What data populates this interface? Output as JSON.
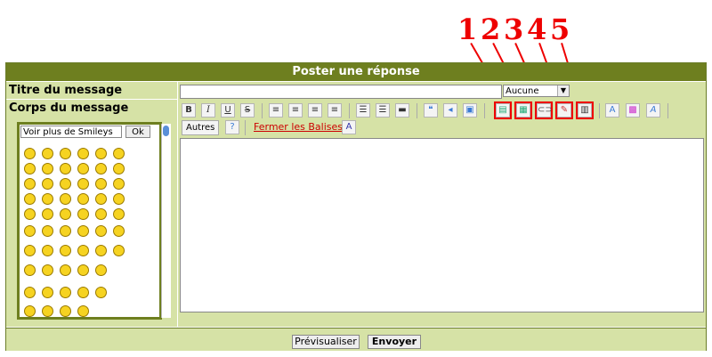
{
  "header": {
    "title": "Poster une réponse"
  },
  "labels": {
    "titre": "Titre du message",
    "corps": "Corps du message"
  },
  "title_input": {
    "value": ""
  },
  "icon_select": {
    "value": "Aucune"
  },
  "toolbar": {
    "bold": "B",
    "italic": "I",
    "underline": "U",
    "strike": "S",
    "autres": "Autres",
    "fermer": "Fermer les Balises"
  },
  "smileys": {
    "select": "Voir plus de Smileys",
    "ok": "Ok"
  },
  "annotations": [
    "1",
    "2",
    "3",
    "4",
    "5"
  ],
  "footer": {
    "preview": "Prévisualiser",
    "send": "Envoyer"
  }
}
